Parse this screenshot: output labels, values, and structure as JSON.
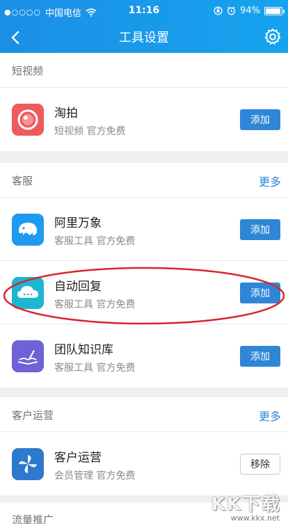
{
  "status": {
    "signal": "●○○○○",
    "carrier": "中国电信",
    "time": "11:16",
    "battery": "94%",
    "battery_level": 0.94
  },
  "nav": {
    "title": "工具设置",
    "back_icon": "chevron-left-icon",
    "settings_icon": "gear-icon"
  },
  "sections": [
    {
      "title": "短视频",
      "more": "",
      "items": [
        {
          "name": "淘拍",
          "desc": "短视频 官方免费",
          "action": "添加",
          "icon": "camera-lens-icon",
          "color": "#ee5b5c"
        }
      ]
    },
    {
      "title": "客服",
      "more": "更多",
      "items": [
        {
          "name": "阿里万象",
          "desc": "客服工具 官方免费",
          "action": "添加",
          "icon": "elephant-icon",
          "color": "#1e9af0"
        },
        {
          "name": "自动回复",
          "desc": "客服工具 官方免费",
          "action": "添加",
          "icon": "cloud-chat-icon",
          "color": "#1cb6d2"
        },
        {
          "name": "团队知识库",
          "desc": "客服工具 官方免费",
          "action": "添加",
          "icon": "open-book-icon",
          "color": "#6f61d6"
        }
      ]
    },
    {
      "title": "客户运营",
      "more": "更多",
      "items": [
        {
          "name": "客户运营",
          "desc": "会员管理 官方免费",
          "action": "移除",
          "icon": "pinwheel-icon",
          "color": "#2d79cc"
        }
      ]
    }
  ],
  "next_section_title": "流量推广",
  "watermark": {
    "text": "KK下载",
    "url": "www.kkx.net"
  },
  "colors": {
    "header": "#1b8fe6",
    "button": "#2f86d6",
    "link": "#2b86d8",
    "annotation": "#d8262b"
  }
}
